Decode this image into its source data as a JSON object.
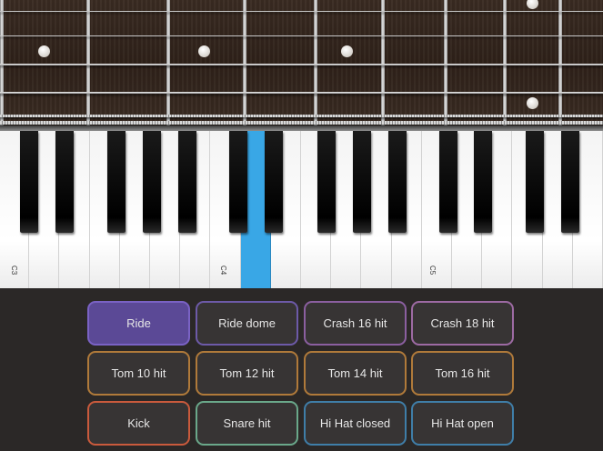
{
  "piano": {
    "octave_labels": [
      "C3",
      "C4",
      "C5"
    ],
    "active_key": "D4"
  },
  "pads": [
    {
      "label": "Ride",
      "color": "#7a62c4",
      "fill": "#5b4996"
    },
    {
      "label": "Ride dome",
      "color": "#6d5aa8",
      "fill": "#373434"
    },
    {
      "label": "Crash 16 hit",
      "color": "#8b5fa0",
      "fill": "#373434"
    },
    {
      "label": "Crash 18 hit",
      "color": "#9d6aa3",
      "fill": "#373434"
    },
    {
      "label": "Tom 10 hit",
      "color": "#b07a3a",
      "fill": "#373434"
    },
    {
      "label": "Tom 12 hit",
      "color": "#b07a3a",
      "fill": "#373434"
    },
    {
      "label": "Tom 14 hit",
      "color": "#b07a3a",
      "fill": "#373434"
    },
    {
      "label": "Tom 16 hit",
      "color": "#b07a3a",
      "fill": "#373434"
    },
    {
      "label": "Kick",
      "color": "#c95a3c",
      "fill": "#373434"
    },
    {
      "label": "Snare hit",
      "color": "#6aa88a",
      "fill": "#373434"
    },
    {
      "label": "Hi Hat closed",
      "color": "#3f7ea8",
      "fill": "#373434"
    },
    {
      "label": "Hi Hat open",
      "color": "#3f7ea8",
      "fill": "#373434"
    }
  ]
}
